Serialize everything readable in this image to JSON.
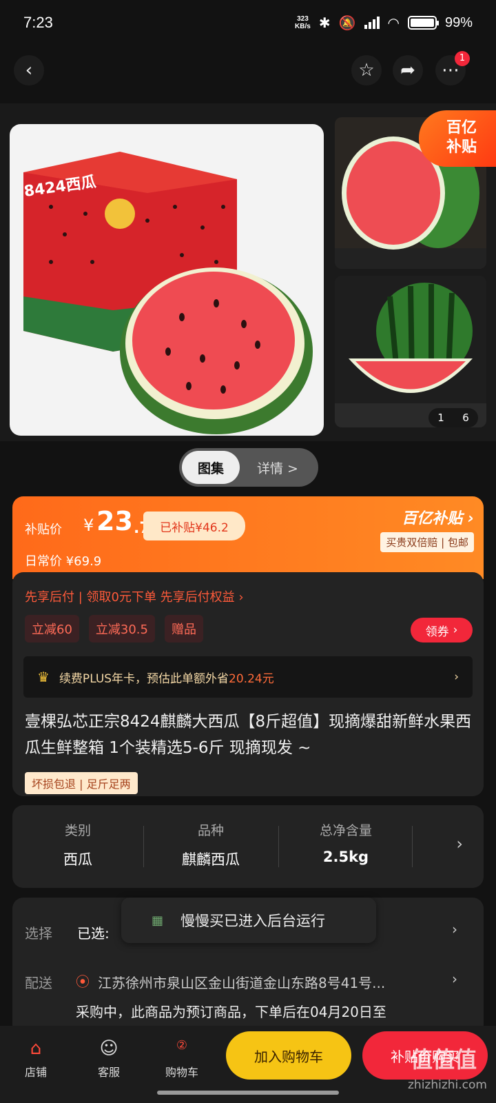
{
  "status": {
    "time": "7:23",
    "speed_top": "323",
    "speed_bottom": "KB/s",
    "battery": "99%"
  },
  "topbar": {
    "more_badge": "1"
  },
  "gallery": {
    "subsidy_line1": "百亿",
    "subsidy_line2": "补贴",
    "main_box_text": "8424西瓜",
    "counter_current": "1",
    "counter_total": "6",
    "tab_gallery": "图集",
    "tab_details": "详情 >"
  },
  "price": {
    "label": "补贴价",
    "currency": "¥",
    "integer": "23",
    "decimal": ".7",
    "subsidy_amount": "已补贴¥46.2",
    "regular": "日常价 ¥69.9",
    "brand": "百亿补贴",
    "brand_sub": "买贵双倍赔 | 包邮"
  },
  "promo": {
    "pay_later": "先享后付 | 领取0元下单 先享后付权益 ›",
    "chips": [
      "立减60",
      "立减30.5",
      "赠品"
    ],
    "coupon": "领券",
    "plus_text": "续费PLUS年卡，预估此单额外省",
    "plus_amount": "20.24元",
    "title": "壹棵弘芯正宗8424麒麟大西瓜【8斤超值】现摘爆甜新鲜水果西瓜生鲜整箱 1个装精选5-6斤 现摘现发 ~",
    "service_tag": "坏损包退 | 足斤足两"
  },
  "specs": [
    {
      "k": "类别",
      "v": "西瓜"
    },
    {
      "k": "品种",
      "v": "麒麟西瓜"
    },
    {
      "k": "总净含量",
      "v": "2.5kg"
    }
  ],
  "selection": {
    "select_label": "选择",
    "selected": "已选:",
    "ship_label": "配送",
    "address": "江苏徐州市泉山区金山街道金山东路8号41号...",
    "presale": "采购中，此商品为预订商品，下单后在04月20日至"
  },
  "toast": "慢慢买已进入后台运行",
  "bottom": {
    "shop": "店铺",
    "service": "客服",
    "cart": "购物车",
    "cart_badge": "②",
    "add_cart": "加入购物车",
    "buy": "补贴价购买"
  },
  "watermark": {
    "main": "值值值",
    "url": "zhizhizhi.com"
  },
  "colors": {
    "accent": "#ff6a1a",
    "red": "#f2273a",
    "yellow": "#f6c414"
  }
}
